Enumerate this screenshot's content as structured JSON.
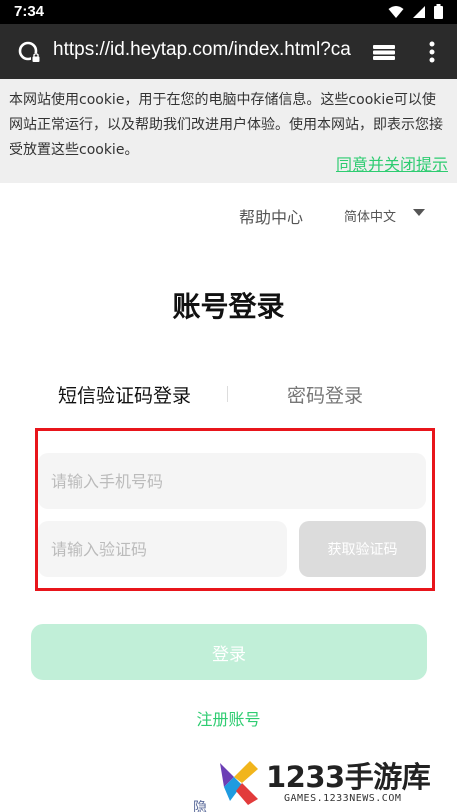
{
  "status_bar": {
    "time": "7:34",
    "icons": [
      "wifi-icon",
      "signal-icon",
      "battery-icon"
    ]
  },
  "browser": {
    "url": "https://id.heytap.com/index.html?ca",
    "site_icon": "site-identity-icon",
    "tab_switcher_icon": "tab-switcher-icon",
    "menu_icon": "more-vert-icon"
  },
  "cookie_banner": {
    "text": "本网站使用cookie，用于在您的电脑中存储信息。这些cookie可以使网站正常运行，以及帮助我们改进用户体验。使用本网站，即表示您接受放置这些cookie。",
    "accept_link": "同意并关闭提示"
  },
  "header": {
    "help": "帮助中心",
    "language": "简体中文"
  },
  "login": {
    "title": "账号登录",
    "tab_sms": "短信验证码登录",
    "tab_password": "密码登录",
    "phone_placeholder": "请输入手机号码",
    "code_placeholder": "请输入验证码",
    "get_code_label": "获取验证码",
    "submit_label": "登录",
    "register_link": "注册账号",
    "privacy_partial": "隐"
  },
  "watermark": {
    "main": "1233手游库",
    "sub": "GAMES.1233NEWS.COM"
  },
  "colors": {
    "accent_green": "#2ecc71",
    "login_button": "#c1efd8",
    "highlight_red": "#e8151b",
    "toolbar": "#2b2b2b"
  }
}
